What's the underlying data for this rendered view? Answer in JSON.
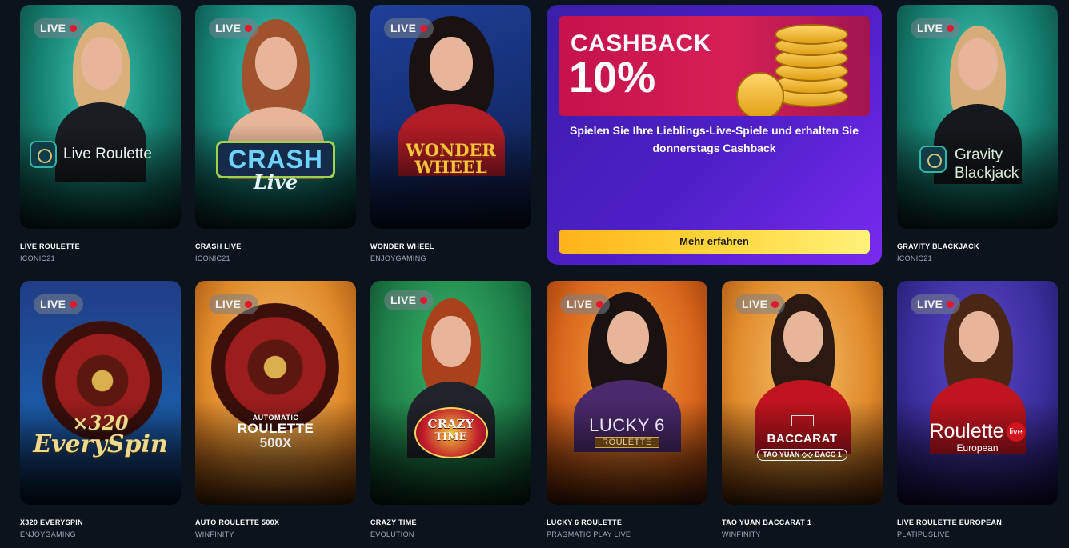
{
  "promo": {
    "title": "CASHBACK",
    "percent": "10%",
    "text": "Spielen Sie Ihre Lieblings-Live-Spiele und erhalten Sie donnerstags Cashback",
    "button": "Mehr erfahren"
  },
  "badge": "LIVE",
  "games": [
    {
      "title": "LIVE ROULETTE",
      "provider": "ICONIC21",
      "logo": "Live Roulette"
    },
    {
      "title": "CRASH LIVE",
      "provider": "ICONIC21",
      "logo": "CRASH",
      "logo_sub": "Live"
    },
    {
      "title": "WONDER WHEEL",
      "provider": "ENJOYGAMING",
      "logo": "WONDER",
      "logo_sub": "WHEEL"
    },
    {
      "title": "GRAVITY BLACKJACK",
      "provider": "ICONIC21",
      "logo": "Gravity",
      "logo_sub": "Blackjack"
    },
    {
      "title": "X320 EVERYSPIN",
      "provider": "ENJOYGAMING",
      "logo": "×320",
      "logo_sub": "EverySpin"
    },
    {
      "title": "AUTO ROULETTE 500X",
      "provider": "WINFINITY",
      "logo_top": "AUTOMATIC",
      "logo": "ROULETTE",
      "logo_sub": "500X"
    },
    {
      "title": "CRAZY TIME",
      "provider": "EVOLUTION",
      "logo": "CRAZY",
      "logo_sub": "TIME"
    },
    {
      "title": "LUCKY 6 ROULETTE",
      "provider": "PRAGMATIC PLAY LIVE",
      "logo": "LUCKY 6",
      "logo_sub": "ROULETTE"
    },
    {
      "title": "TAO YUAN BACCARAT 1",
      "provider": "WINFINITY",
      "logo": "BACCARAT",
      "logo_sub": "TAO YUAN ◇◇ BACC 1"
    },
    {
      "title": "LIVE ROULETTE EUROPEAN",
      "provider": "PLATIPUSLIVE",
      "logo": "Roulette",
      "logo_badge": "live",
      "logo_sub": "European"
    }
  ],
  "colors": {
    "page_bg": "#0b131d",
    "live_dot": "#e3172e",
    "promo_bg": "#4f1fc9",
    "promo_button": "#ffd63a"
  }
}
